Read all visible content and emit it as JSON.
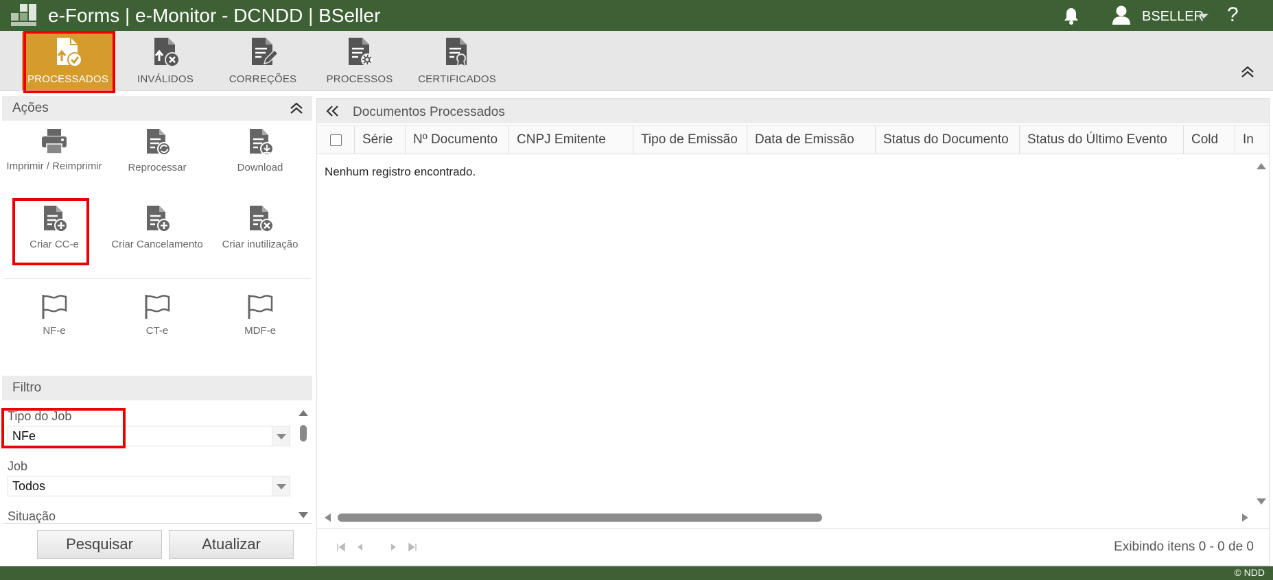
{
  "window": {
    "title": "e-Forms | e-Monitor - DCNDD | BSeller",
    "user": "BSELLER",
    "help_label": "?"
  },
  "menu": {
    "items": [
      {
        "label": "PROCESSADOS",
        "icon": "file-check-icon",
        "active": true
      },
      {
        "label": "INVÁLIDOS",
        "icon": "file-x-icon",
        "active": false
      },
      {
        "label": "CORREÇÕES",
        "icon": "file-edit-icon",
        "active": false
      },
      {
        "label": "PROCESSOS",
        "icon": "file-gear-icon",
        "active": false
      },
      {
        "label": "CERTIFICADOS",
        "icon": "file-certificate-icon",
        "active": false
      }
    ]
  },
  "acoes": {
    "title": "Ações",
    "buttons": [
      {
        "label": "Imprimir / Reimprimir",
        "icon": "printer-icon"
      },
      {
        "label": "Reprocessar",
        "icon": "file-refresh-icon"
      },
      {
        "label": "Download",
        "icon": "file-download-icon"
      },
      {
        "label": "Criar CC-e",
        "icon": "file-plus-icon"
      },
      {
        "label": "Criar Cancelamento",
        "icon": "file-plus-icon"
      },
      {
        "label": "Criar inutilização",
        "icon": "file-x-icon"
      },
      {
        "label": "NF-e",
        "icon": "flag-icon"
      },
      {
        "label": "CT-e",
        "icon": "flag-icon"
      },
      {
        "label": "MDF-e",
        "icon": "flag-icon"
      }
    ]
  },
  "filtro": {
    "title": "Filtro",
    "tipo_job": {
      "label": "Tipo do Job",
      "value": "NFe"
    },
    "job": {
      "label": "Job",
      "value": "Todos"
    },
    "situacao": {
      "label": "Situação"
    },
    "search_button": "Pesquisar",
    "refresh_button": "Atualizar"
  },
  "documentos": {
    "title": "Documentos Processados",
    "columns": [
      "Série",
      "Nº Documento",
      "CNPJ Emitente",
      "Tipo de Emissão",
      "Data de Emissão",
      "Status do Documento",
      "Status do Último Evento",
      "Cold",
      "In"
    ],
    "empty_message": "Nenhum registro encontrado.",
    "pager_info": "Exibindo itens 0 - 0 de 0"
  },
  "footer": {
    "copyright": "© NDD"
  },
  "colors": {
    "brand_green": "#3d6134",
    "active_orange": "#d69b2d",
    "highlight_red": "#ee0000"
  }
}
